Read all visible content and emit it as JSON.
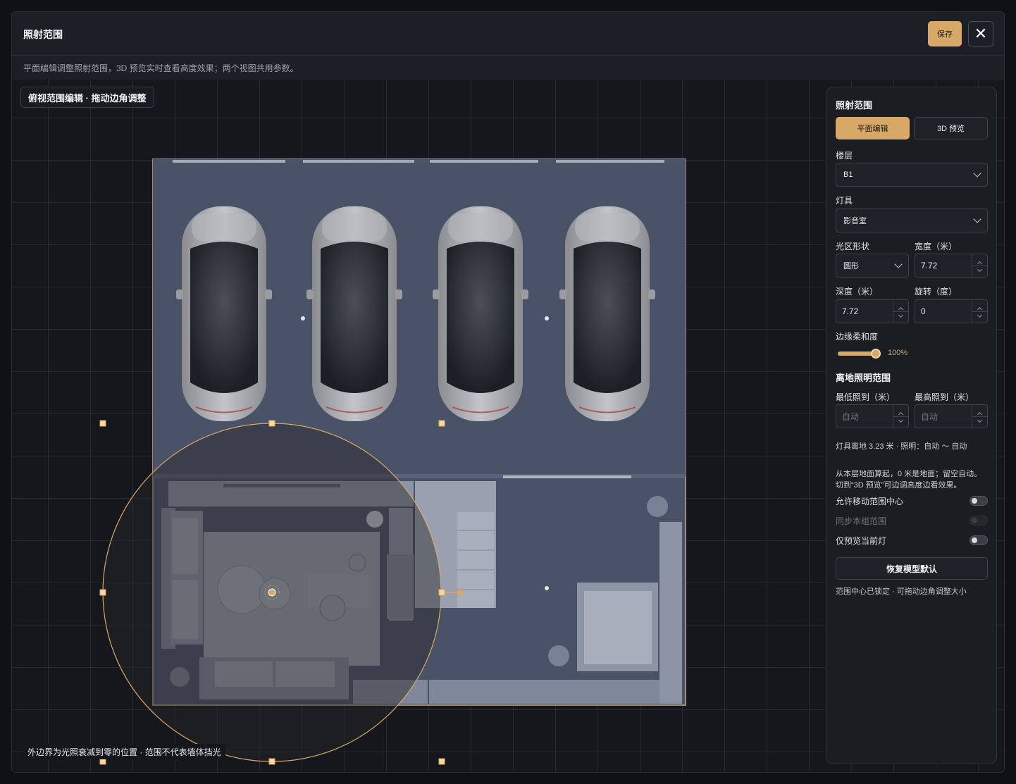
{
  "modal": {
    "title": "照射范围",
    "save_label": "保存",
    "close_icon": "close-icon",
    "subtitle": "平面编辑调整照射范围，3D 预览实时查看高度效果；两个视图共用参数。"
  },
  "canvas": {
    "mode_badge": "俯视范围编辑 · 拖动边角调整",
    "footnote": "外边界为光照衰减到零的位置 · 范围不代表墙体挡光",
    "accent_color": "#d7a867",
    "floor_color": "#4a5268"
  },
  "panel": {
    "title": "照射范围",
    "tabs": [
      {
        "label": "平面编辑",
        "active": true
      },
      {
        "label": "3D 预览",
        "active": false
      }
    ],
    "floor": {
      "label": "楼层",
      "value": "B1"
    },
    "fixture": {
      "label": "灯具",
      "value": "影音室"
    },
    "shape": {
      "label": "光区形状",
      "value": "圆形"
    },
    "width": {
      "label": "宽度（米）",
      "value": "7.72"
    },
    "depth": {
      "label": "深度（米）",
      "value": "7.72"
    },
    "rotation": {
      "label": "旋转（度）",
      "value": "0"
    },
    "softness": {
      "label": "边缘柔和度",
      "value": "100%",
      "percent": 100
    },
    "height_section": {
      "title": "离地照明范围",
      "min_label": "最低照到（米）",
      "min_placeholder": "自动",
      "max_label": "最高照到（米）",
      "max_placeholder": "自动"
    },
    "fixture_info": "灯具离地 3.23 米 · 照明：自动 ～ 自动",
    "help_line1": "从本层地面算起，0 米是地面；留空自动。",
    "help_line2": "切到“3D 预览”可边调高度边看效果。",
    "toggles": [
      {
        "label": "允许移动范围中心",
        "on": false,
        "enabled": true
      },
      {
        "label": "同步本组范围",
        "on": false,
        "enabled": false
      },
      {
        "label": "仅预览当前灯",
        "on": false,
        "enabled": true
      }
    ],
    "reset_label": "恢复模型默认",
    "status": "范围中心已锁定 · 可拖动边角调整大小"
  }
}
